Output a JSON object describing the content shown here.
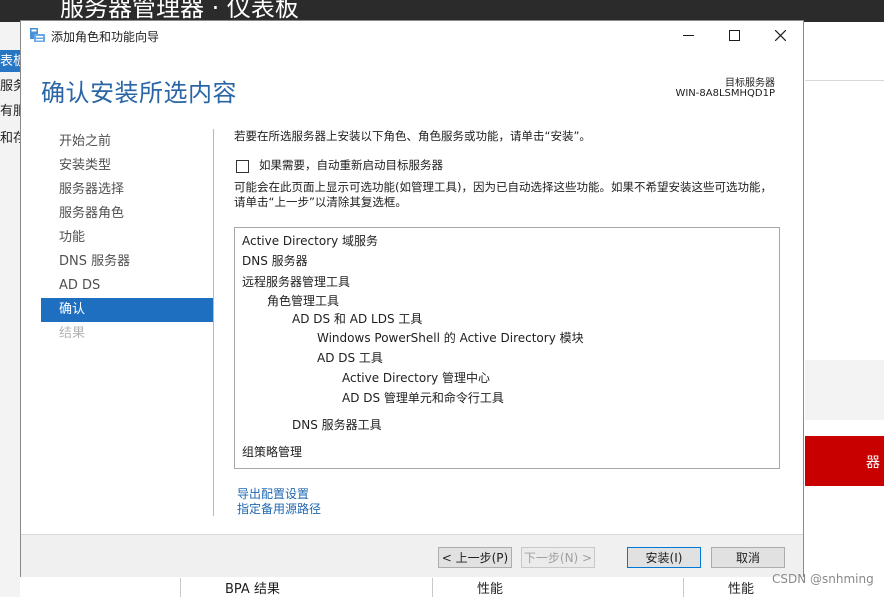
{
  "background": {
    "app_title": "服务器管理器 · 仪表板",
    "nav_items": [
      "表板",
      "服务器",
      "有服务器",
      "和存储服务"
    ],
    "red_tile_text": "器",
    "bottom_cells": [
      "BPA 结果",
      "性能",
      "性能"
    ],
    "watermark": "CSDN @snhming"
  },
  "dialog": {
    "title": "添加角色和功能向导",
    "heading": "确认安装所选内容",
    "target_label": "目标服务器",
    "target_name": "WIN-8A8LSMHQD1P",
    "window_controls": {
      "minimize": "—",
      "maximize": "☐",
      "close": "✕"
    },
    "steps": [
      {
        "label": "开始之前",
        "state": "normal"
      },
      {
        "label": "安装类型",
        "state": "normal"
      },
      {
        "label": "服务器选择",
        "state": "normal"
      },
      {
        "label": "服务器角色",
        "state": "normal"
      },
      {
        "label": "功能",
        "state": "normal"
      },
      {
        "label": "DNS 服务器",
        "state": "normal"
      },
      {
        "label": "AD DS",
        "state": "normal"
      },
      {
        "label": "确认",
        "state": "active"
      },
      {
        "label": "结果",
        "state": "disabled"
      }
    ],
    "intro": "若要在所选服务器上安装以下角色、角色服务或功能，请单击“安装”。",
    "restart_checkbox": {
      "label": "如果需要，自动重新启动目标服务器",
      "checked": false
    },
    "note": "可能会在此页面上显示可选功能(如管理工具)，因为已自动选择这些功能。如果不希望安装这些可选功能，请单击“上一步”以清除其复选框。",
    "features": [
      {
        "label": "Active Directory 域服务",
        "level": 0
      },
      {
        "label": "DNS 服务器",
        "level": 0
      },
      {
        "label": "远程服务器管理工具",
        "level": 0
      },
      {
        "label": "角色管理工具",
        "level": 1
      },
      {
        "label": "AD DS 和 AD LDS 工具",
        "level": 2
      },
      {
        "label": "Windows PowerShell 的 Active Directory 模块",
        "level": 3
      },
      {
        "label": "AD DS 工具",
        "level": 3
      },
      {
        "label": "Active Directory 管理中心",
        "level": 4
      },
      {
        "label": "AD DS 管理单元和命令行工具",
        "level": 4
      },
      {
        "label": "DNS 服务器工具",
        "level": 2
      },
      {
        "label": "组策略管理",
        "level": 0
      }
    ],
    "links": {
      "export": "导出配置设置",
      "alt_source": "指定备用源路径"
    },
    "buttons": {
      "previous": "< 上一步(P)",
      "next": "下一步(N) >",
      "install": "安装(I)",
      "cancel": "取消"
    }
  },
  "colors": {
    "accent": "#1e6fc0",
    "heading": "#2a66a6",
    "link": "#1f67b0",
    "red_tile": "#c90000"
  }
}
